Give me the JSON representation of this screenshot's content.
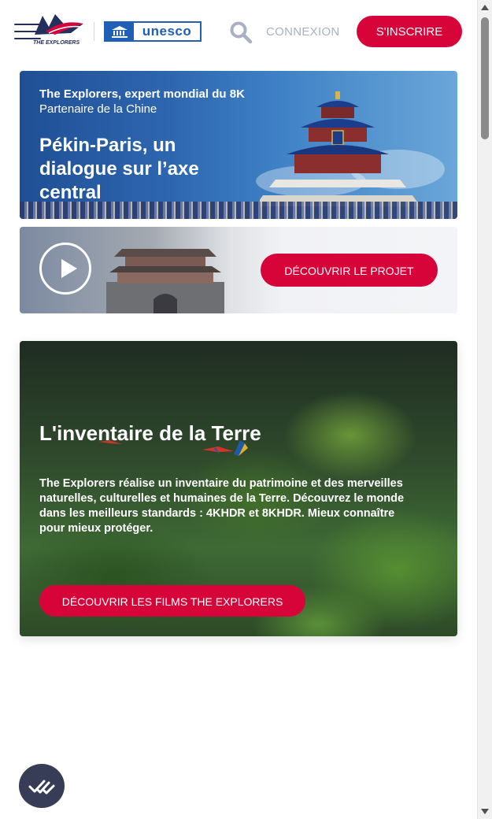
{
  "header": {
    "logo_text": "THE EXPLORERS",
    "partner_logo_text": "unesco",
    "login_label": "CONNEXION",
    "signup_label": "S'INSCRIRE"
  },
  "hero": {
    "subtitle_bold": "The Explorers, expert mondial du 8K",
    "subtitle": "Partenaire de la Chine",
    "title": "Pékin-Paris, un dialogue sur l’axe central"
  },
  "project_banner": {
    "button_label": "DÉCOUVRIR LE PROJET"
  },
  "earth_section": {
    "title": "L'inventaire de la Terre",
    "description": "The Explorers réalise un inventaire du patrimoine et des merveilles naturelles, culturelles et humaines de la Terre. Découvrez le monde dans les meilleurs standards : 4KHDR et 8KHDR. Mieux connaître pour mieux protéger.",
    "button_label": "DÉCOUVRIR LES FILMS THE EXPLORERS"
  },
  "colors": {
    "accent": "#d7043a",
    "navy": "#23305e",
    "unesco_blue": "#1f5fb5",
    "muted": "#a9b0c4"
  },
  "icons": [
    "menu-icon",
    "search-icon",
    "play-icon",
    "cookie-settings-icon",
    "unesco-temple-icon"
  ]
}
